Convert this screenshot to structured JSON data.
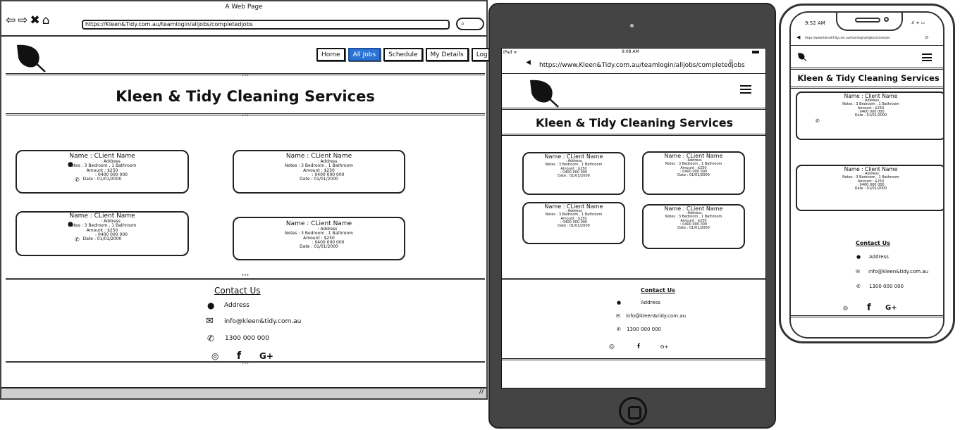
{
  "desktop": {
    "window_title": "A Web Page",
    "url": "https://Kleen&Tidy.com.au/teamlogin/alljobs/completedjobs",
    "nav": [
      "Home",
      "All Jobs",
      "Schedule",
      "My Details",
      "Log Out"
    ],
    "active_nav": "All Jobs",
    "site_title": "Kleen & Tidy Cleaning Services"
  },
  "job_card": {
    "name": "Name : CLient Name",
    "address": ": Address",
    "notes": "Notes : 3 Bedroom , 1 Bathroom",
    "amount": "Amount : $250",
    "phone": ": 0400 000 000",
    "date": "Date : 01/01/2000"
  },
  "job_card_alt": {
    "name": "Name : Client Name"
  },
  "contact": {
    "title": "Contact Us",
    "address": "Address",
    "email": "info@kleen&tidy.com.au",
    "phone": "1300 000 000",
    "socials": [
      "◎",
      "f",
      "G+"
    ]
  },
  "tablet": {
    "status_left": "iPad ᯤ",
    "status_time": "9:08 AM",
    "url": "https://www.Kleen&Tidy.com.au/teamlogin/alljobs/completedjobs",
    "site_title": "Kleen & Tidy Cleaning Services"
  },
  "phone": {
    "status_time": "9:52 AM",
    "url": "https://www.Kleen&Tidy.com.au/teamlogin/alljobs/activejobs",
    "site_title": "Kleen & Tidy Cleaning Services"
  },
  "icons": {
    "leaf": "leaf-icon",
    "pin": "map-pin-icon",
    "phone": "phone-icon",
    "mail": "mail-icon",
    "menu": "hamburger-menu-icon",
    "search": "search-icon"
  }
}
